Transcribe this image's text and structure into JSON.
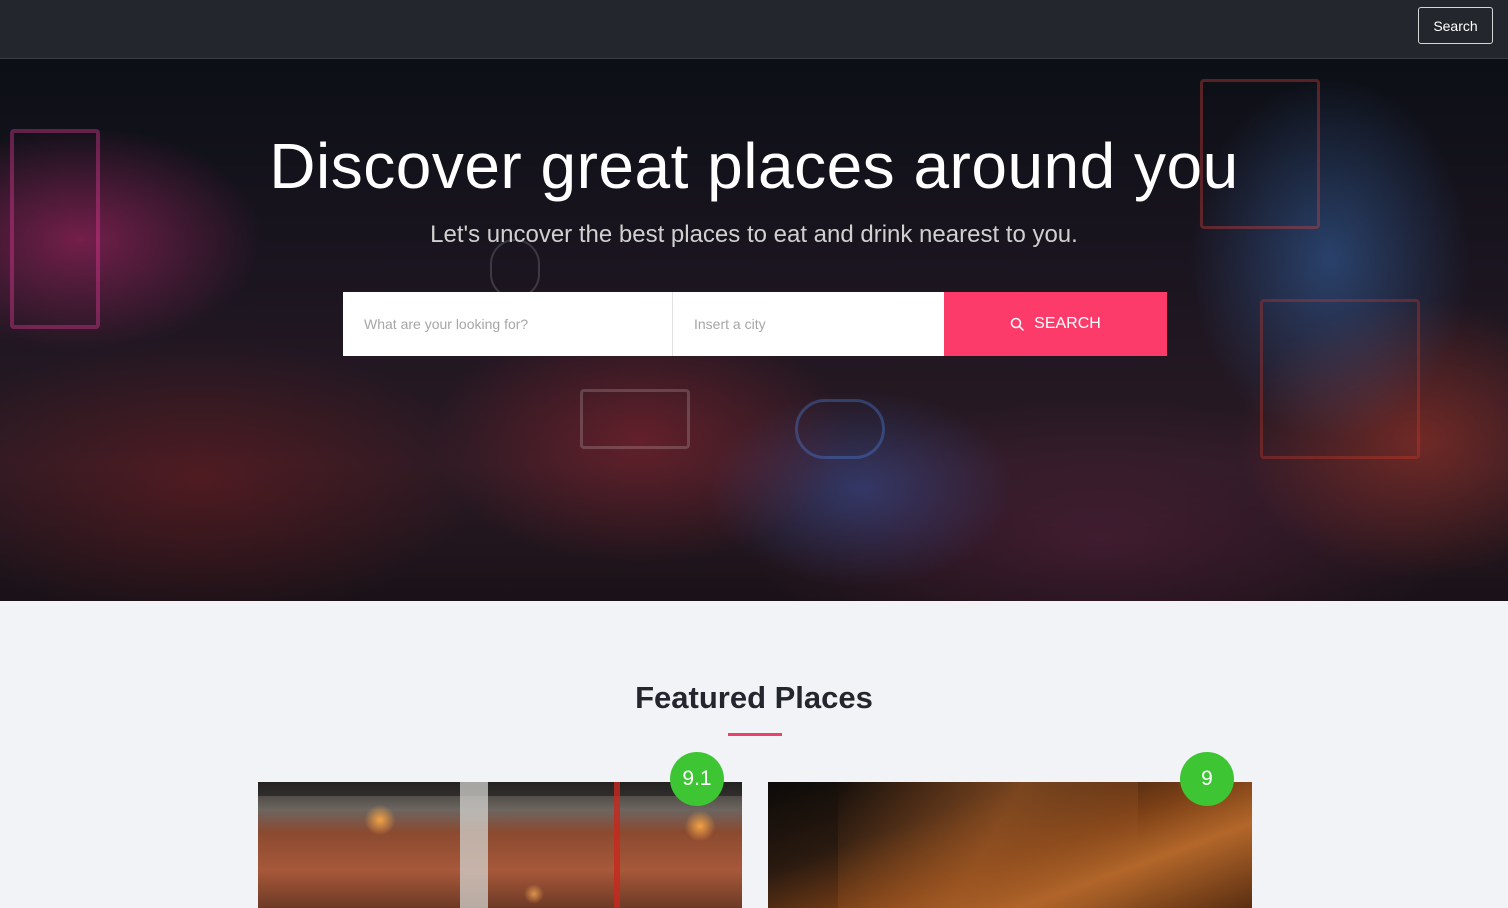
{
  "topbar": {
    "search_button_label": "Search"
  },
  "hero": {
    "title": "Discover great places around you",
    "subtitle": "Let's uncover the best places to eat and drink nearest to you.",
    "search": {
      "what_placeholder": "What are your looking for?",
      "city_placeholder": "Insert a city",
      "button_label": "SEARCH",
      "button_icon": "search-icon",
      "button_color": "#fd3b6b"
    }
  },
  "featured": {
    "title": "Featured Places",
    "underline_color": "#e8416a",
    "places": [
      {
        "rating": "9.1",
        "badge_color": "#3ec534"
      },
      {
        "rating": "9",
        "badge_color": "#3ec534"
      }
    ]
  }
}
